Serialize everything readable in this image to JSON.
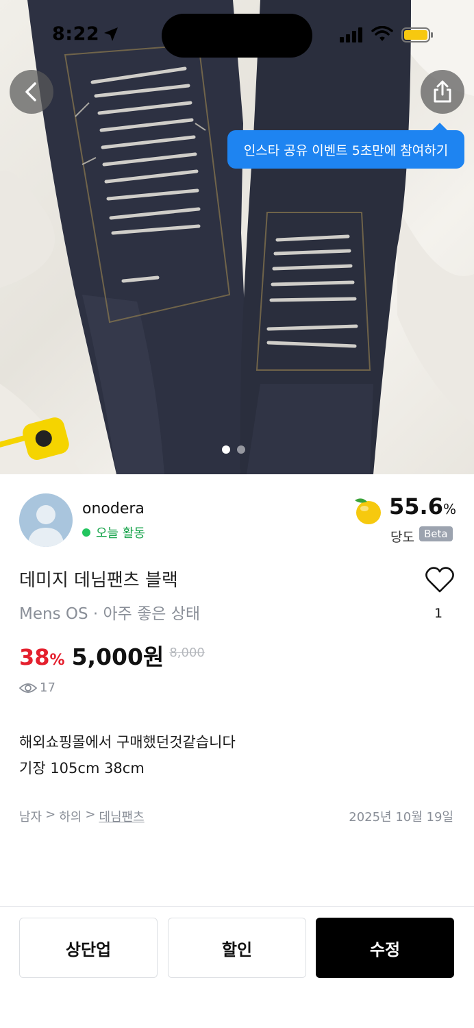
{
  "status_bar": {
    "time": "8:22",
    "battery_color": "#f7c80f"
  },
  "hero": {
    "tooltip": "인스타 공유 이벤트 5초만에 참여하기",
    "image_count": 2,
    "active_index": 0
  },
  "seller": {
    "name": "onodera",
    "activity": "오늘 활동",
    "sweetness_value": "55.6",
    "sweetness_unit": "%",
    "sweetness_label": "당도",
    "beta_badge": "Beta"
  },
  "product": {
    "title": "데미지 데님팬츠 블랙",
    "subtitle": "Mens OS · 아주 좋은 상태",
    "like_count": "1",
    "discount_value": "38",
    "discount_unit": "%",
    "price": "5,000원",
    "original_price": "8,000",
    "views": "17",
    "description_lines": [
      "해외쇼핑몰에서 구매했던것같습니다",
      "기장 105cm 38cm"
    ]
  },
  "category": {
    "level1": "남자",
    "sep1": ">",
    "level2": "하의",
    "sep2": ">",
    "level3": "데님팬츠",
    "date": "2025년 10월 19일"
  },
  "actions": {
    "bump_label": "상단업",
    "discount_label": "할인",
    "edit_label": "수정"
  },
  "colors": {
    "discount": "#e4202e",
    "active": "#22c55e",
    "tooltip": "#1e84f1"
  }
}
